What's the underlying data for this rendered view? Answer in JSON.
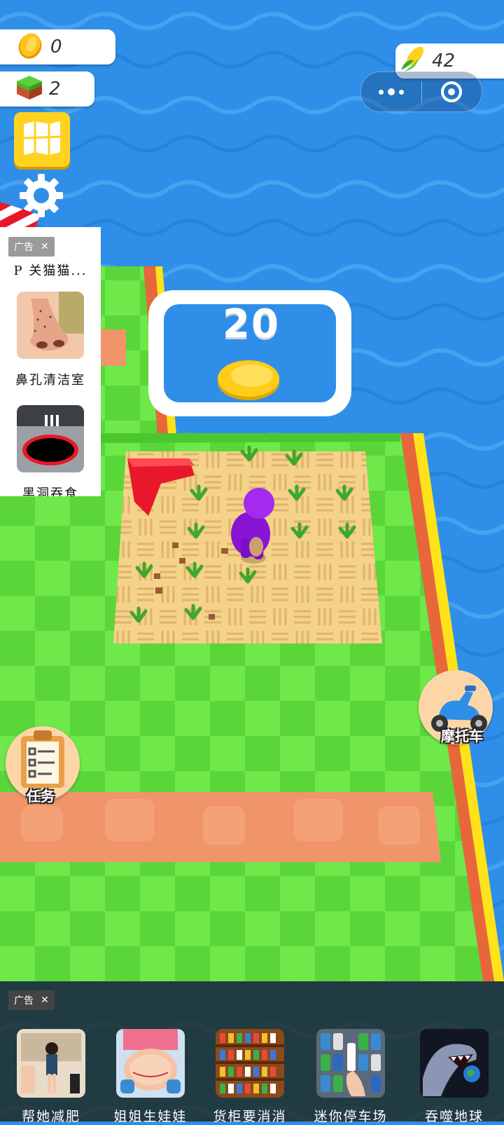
{
  "hud": {
    "coins": "0",
    "blocks": "2",
    "corn": "42",
    "map_icon": "map-icon",
    "settings_icon": "gear-icon"
  },
  "miniprogram": {
    "more_icon": "more-dots-icon",
    "close_icon": "target-icon"
  },
  "world": {
    "purchase_price": "20",
    "colors": {
      "water": "#2f8fe8",
      "grass_light": "#6fe84a",
      "grass_dark": "#5ad638",
      "soil": "#f4d28a",
      "path": "#f0956a",
      "player": "#9a1fe0",
      "arrow": "#e8182a"
    }
  },
  "side_ad": {
    "tag": "广告",
    "close": "✕",
    "games": [
      {
        "label": "P 关猫猫..."
      },
      {
        "label": "鼻孔清洁室"
      },
      {
        "label": "黑洞吞食"
      }
    ]
  },
  "buttons": {
    "motorcycle": "摩托车",
    "tasks": "任务"
  },
  "bottom_ad": {
    "tag": "广告",
    "close": "✕",
    "games": [
      {
        "label": "帮她减肥"
      },
      {
        "label": "姐姐生娃娃"
      },
      {
        "label": "货柜要消消"
      },
      {
        "label": "迷你停车场"
      },
      {
        "label": "吞噬地球"
      }
    ]
  }
}
